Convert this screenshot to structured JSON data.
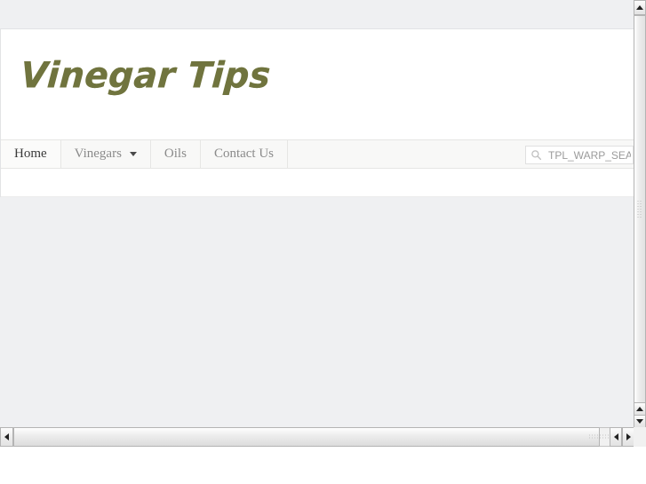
{
  "browser": {
    "page_background": "#eff0f2",
    "content_background": "#ffffff"
  },
  "site": {
    "logo_text": "Vinegar Tips",
    "logo_color": "#70743e"
  },
  "nav": {
    "items": [
      {
        "label": "Home",
        "active": true,
        "has_dropdown": false
      },
      {
        "label": "Vinegars",
        "active": false,
        "has_dropdown": true
      },
      {
        "label": "Oils",
        "active": false,
        "has_dropdown": false
      },
      {
        "label": "Contact Us",
        "active": false,
        "has_dropdown": false
      }
    ]
  },
  "search": {
    "icon": "search-icon",
    "value": "",
    "placeholder": "TPL_WARP_SEARCH"
  },
  "scrollbars": {
    "vertical": {
      "up_arrow": "▲",
      "down_arrow": "▼",
      "grip": "dotted-grip"
    },
    "horizontal": {
      "left_arrow": "◀",
      "right_arrow": "▶",
      "grip": "dotted-grip"
    }
  }
}
